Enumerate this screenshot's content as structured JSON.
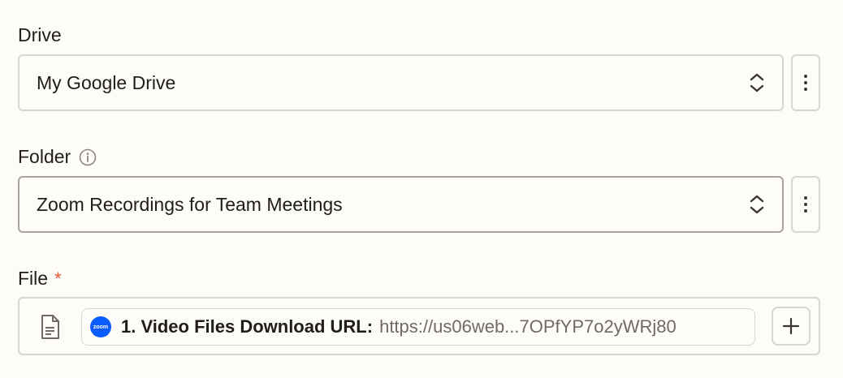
{
  "drive": {
    "label": "Drive",
    "value": "My Google Drive"
  },
  "folder": {
    "label": "Folder",
    "value": "Zoom Recordings for Team Meetings"
  },
  "file": {
    "label": "File",
    "required_marker": "*",
    "pill": {
      "logo_text": "zoom",
      "label": "1. Video Files Download URL:",
      "value": "https://us06web...7OPfYP7o2yWRj80"
    }
  },
  "colors": {
    "background": "#fdfcf8",
    "border": "#d9d6cf",
    "required": "#e4572e",
    "zoom_blue": "#0b5cff"
  },
  "icons": {
    "chevron": "chevron-up-down-icon",
    "more": "more-vertical-icon",
    "info": "info-icon",
    "document": "document-icon",
    "plus": "plus-icon"
  }
}
